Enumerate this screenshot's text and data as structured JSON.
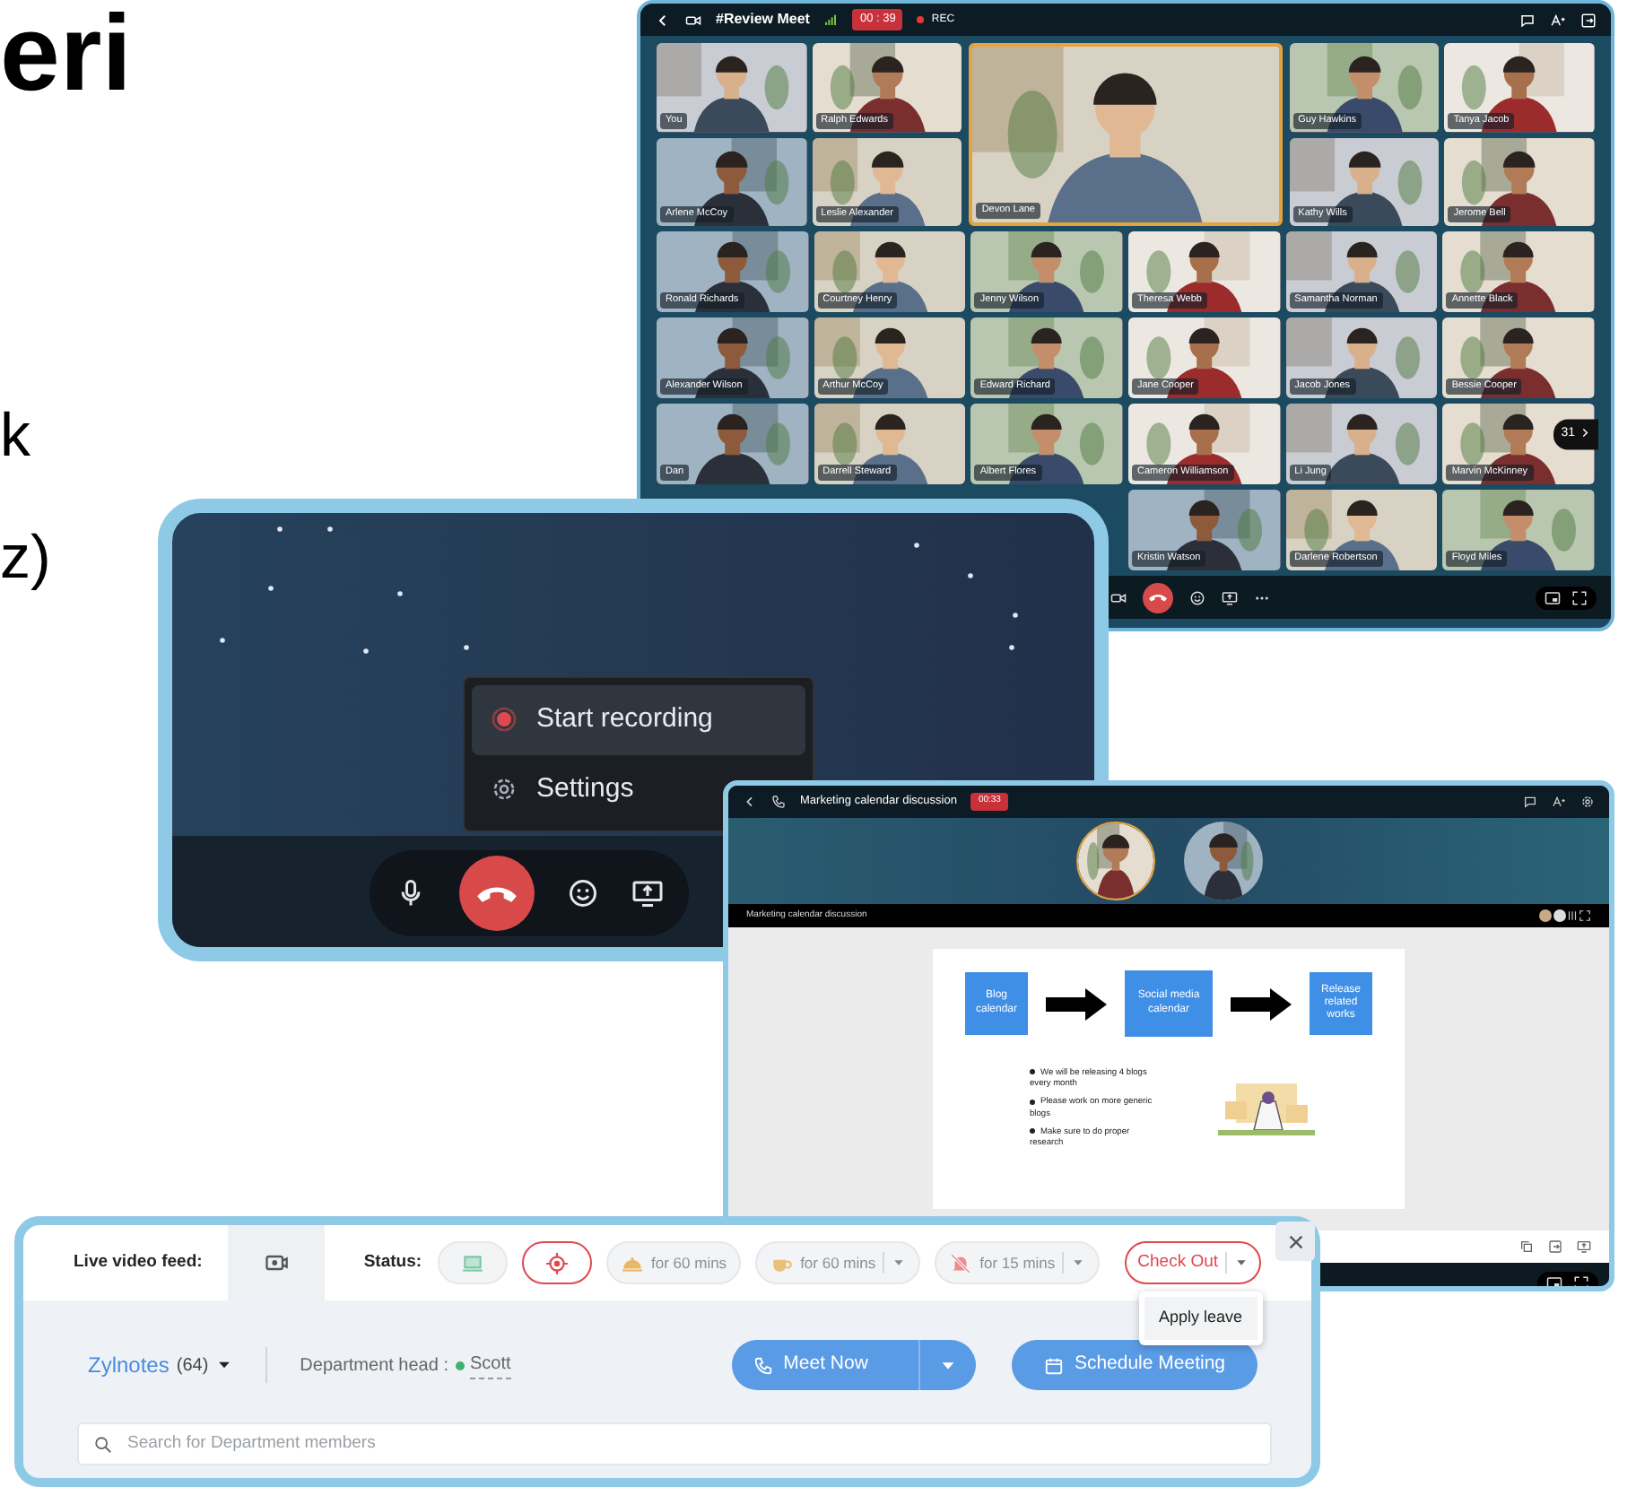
{
  "backdrop_text": [
    "eri",
    "k",
    "z)"
  ],
  "review_meet": {
    "title": "#Review Meet",
    "timer": "00 : 39",
    "rec_label": "REC",
    "left_tiles": [
      "You",
      "Ralph Edwards",
      "Arlene McCoy",
      "Leslie Alexander"
    ],
    "spotlight": "Devon Lane",
    "right_tiles": [
      "Guy Hawkins",
      "Tanya Jacob",
      "Kathy Wills",
      "Jerome Bell"
    ],
    "grid_tiles": [
      "Ronald Richards",
      "Courtney Henry",
      "Jenny Wilson",
      "Theresa Webb",
      "Samantha Norman",
      "Annette Black",
      "Alexander Wilson",
      "Arthur McCoy",
      "Edward Richard",
      "Jane Cooper",
      "Jacob Jones",
      "Bessie Cooper",
      "Dan",
      "Darrell Steward",
      "Albert Flores",
      "Cameron Williamson",
      "Li Jung",
      "Marvin McKinney",
      "Kristin Watson",
      "Darlene Robertson",
      "Floyd Miles"
    ],
    "more_count": "31"
  },
  "recording": {
    "menu": [
      {
        "label": "Start recording",
        "kind": "record",
        "selected": true
      },
      {
        "label": "Settings",
        "kind": "settings",
        "selected": false
      }
    ]
  },
  "discussion": {
    "title": "Marketing calendar discussion",
    "timer": "00:33",
    "strip_title": "Marketing calendar discussion",
    "slide": {
      "steps": [
        "Blog calendar",
        "Social media calendar",
        "Release related works"
      ],
      "bullets": [
        "We will be releasing 4 blogs every month",
        "Please work on more generic blogs",
        "Make sure to do proper research"
      ]
    }
  },
  "presence": {
    "live_feed_label": "Live video feed:",
    "status_label": "Status:",
    "statuses": [
      {
        "kind": "monitor",
        "menu": false,
        "selected": false
      },
      {
        "kind": "target",
        "menu": false,
        "selected": true
      },
      {
        "kind": "meal",
        "text": "for 60 mins",
        "menu": false,
        "selected": false
      },
      {
        "kind": "coffee",
        "text": "for 60 mins",
        "menu": true,
        "selected": false
      },
      {
        "kind": "away",
        "text": "for 15 mins",
        "menu": true,
        "selected": false
      }
    ],
    "checkout": {
      "label": "Check Out",
      "menu_items": [
        "Apply leave"
      ]
    },
    "department": "Zylnotes",
    "count": "(64)",
    "head_label": "Department head :",
    "head_name": "Scott",
    "head_online": true,
    "meet_now": "Meet Now",
    "schedule": "Schedule Meeting",
    "search_placeholder": "Search for Department members"
  }
}
